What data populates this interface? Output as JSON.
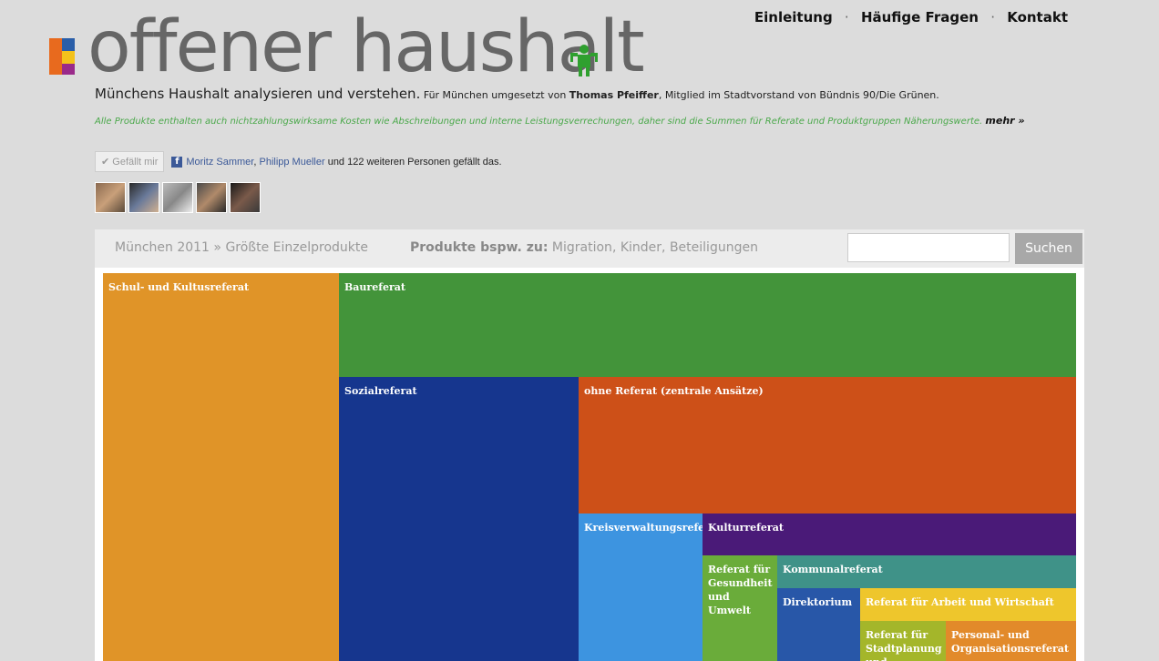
{
  "nav": {
    "einleitung": "Einleitung",
    "sep1": "·",
    "faq": "Häufige Fragen",
    "sep2": "·",
    "kontakt": "Kontakt"
  },
  "logo": {
    "text": "offener haushalt"
  },
  "tagline": {
    "main": "Münchens Haushalt analysieren und verstehen.",
    "pre": " Für München umgesetzt von ",
    "author": "Thomas Pfeiffer",
    "post": ", Mitglied im Stadtvorstand von Bündnis 90/Die Grünen."
  },
  "notice": {
    "text": "Alle Produkte enthalten auch nichtzahlungswirksame Kosten wie Abschreibungen und interne Leistungsverrechungen, daher sind die Summen für Referate und Produktgruppen Näherungswerte. ",
    "more": "mehr »"
  },
  "facebook": {
    "like_label": "✔ Gefällt mir",
    "icon": "f",
    "friend1": "Moritz Sammer",
    "comma": ", ",
    "friend2": "Philipp Mueller",
    "suffix": " und 122 weiteren Personen gefällt das."
  },
  "breadcrumb": {
    "city_year": "München 2011",
    "sep": " » ",
    "current": "Größte Einzelprodukte"
  },
  "examples": {
    "label": "Produkte bspw. zu:",
    "items": [
      "Migration",
      "Kinder",
      "Beteiligungen"
    ],
    "seps": [
      ", ",
      ", "
    ]
  },
  "search": {
    "button": "Suchen",
    "value": ""
  },
  "treemap": {
    "tiles": [
      {
        "label": "Schul- und Kultusreferat",
        "color": "#e09428"
      },
      {
        "label": "Baureferat",
        "color": "#43943a"
      },
      {
        "label": "Sozialreferat",
        "color": "#16368e"
      },
      {
        "label": "ohne Referat (zentrale Ansätze)",
        "color": "#cd5018"
      },
      {
        "label": "Kreisverwaltungsreferat",
        "color": "#3d94e0"
      },
      {
        "label": "Kulturreferat",
        "color": "#4a1a78"
      },
      {
        "label": "Referat für Gesundheit und Umwelt",
        "color": "#6aac3a"
      },
      {
        "label": "Kommunalreferat",
        "color": "#3f9288"
      },
      {
        "label": "Direktorium",
        "color": "#2857a8"
      },
      {
        "label": "Referat für Arbeit und Wirtschaft",
        "color": "#eec62c"
      },
      {
        "label": "Referat für Stadtplanung und",
        "color": "#a4b62a"
      },
      {
        "label": "Personal- und Organisationsreferat",
        "color": "#e28a2a"
      }
    ]
  }
}
